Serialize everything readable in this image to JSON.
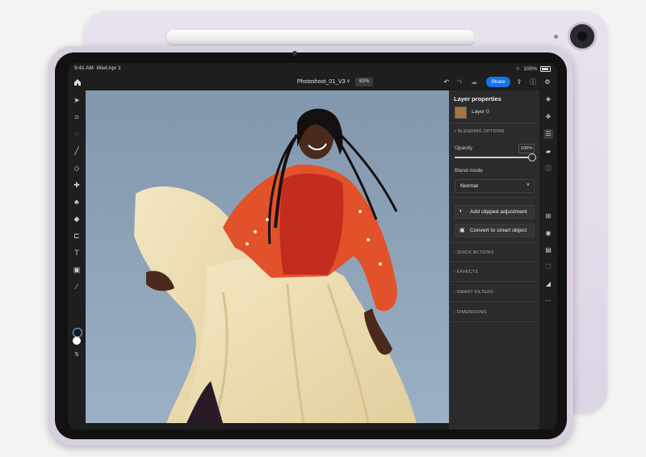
{
  "status_bar": {
    "time": "9:41 AM",
    "date": "Wed Apr 1",
    "battery": "100%"
  },
  "topbar": {
    "doc_title": "Photoshoot_01_V3",
    "zoom": "63%",
    "share_label": "Share"
  },
  "toolbar": {
    "tools": [
      "select-icon",
      "crop-transform-icon",
      "lasso-icon",
      "brush-icon",
      "eraser-icon",
      "healing-icon",
      "clone-stamp-icon",
      "fill-icon",
      "crop-icon",
      "type-icon",
      "place-image-icon",
      "eyedropper-icon"
    ],
    "foreground_color": "#0a1a3a",
    "background_color": "#ffffff"
  },
  "panel": {
    "title": "Layer properties",
    "layer_name": "Layer 0",
    "blending_options": "BLENDING OPTIONS",
    "opacity_label": "Opacity",
    "opacity_value": "100%",
    "blend_mode_label": "Blend mode",
    "blend_mode_value": "Normal",
    "add_clipped": "Add clipped adjustment",
    "convert_smart": "Convert to smart object",
    "sections": [
      "QUICK ACTIONS",
      "EFFECTS",
      "SMART FILTERS",
      "DIMENSIONS"
    ]
  },
  "rail": {
    "icons": [
      "layers-icon",
      "adjustments-icon",
      "properties-icon",
      "comments-icon",
      "info-icon",
      "add-layer-icon",
      "visibility-icon",
      "mask-icon",
      "duplicate-icon",
      "erase-icon",
      "more-icon"
    ]
  },
  "colors": {
    "accent": "#1473e6",
    "panel_bg": "#2b2b2b",
    "app_bg": "#1e1e1e",
    "device_lilac": "#d8d0de"
  }
}
